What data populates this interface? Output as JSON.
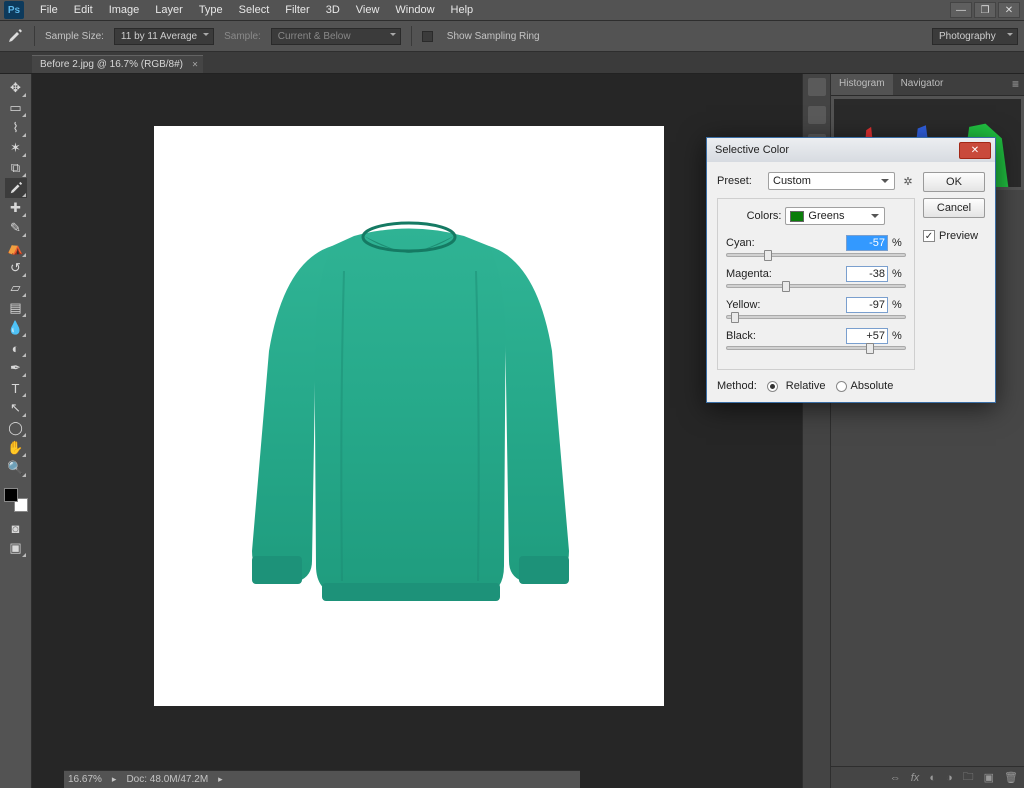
{
  "menubar": {
    "items": [
      "File",
      "Edit",
      "Image",
      "Layer",
      "Type",
      "Select",
      "Filter",
      "3D",
      "View",
      "Window",
      "Help"
    ]
  },
  "optbar": {
    "sample_size_label": "Sample Size:",
    "sample_size_value": "11 by 11 Average",
    "sample_label": "Sample:",
    "sample_value": "Current & Below",
    "ring_label": "Show Sampling Ring",
    "workspace": "Photography"
  },
  "doc": {
    "tab": "Before 2.jpg @ 16.7% (RGB/8#)"
  },
  "panels": {
    "histogram": "Histogram",
    "navigator": "Navigator"
  },
  "status": {
    "zoom": "16.67%",
    "doc": "Doc: 48.0M/47.2M"
  },
  "dialog": {
    "title": "Selective Color",
    "preset_label": "Preset:",
    "preset_value": "Custom",
    "colors_label": "Colors:",
    "colors_value": "Greens",
    "sliders": {
      "cyan": {
        "label": "Cyan:",
        "value": "-57",
        "pct": "%"
      },
      "magenta": {
        "label": "Magenta:",
        "value": "-38",
        "pct": "%"
      },
      "yellow": {
        "label": "Yellow:",
        "value": "-97",
        "pct": "%"
      },
      "black": {
        "label": "Black:",
        "value": "+57",
        "pct": "%"
      }
    },
    "method_label": "Method:",
    "relative": "Relative",
    "absolute": "Absolute",
    "ok": "OK",
    "cancel": "Cancel",
    "preview": "Preview"
  }
}
